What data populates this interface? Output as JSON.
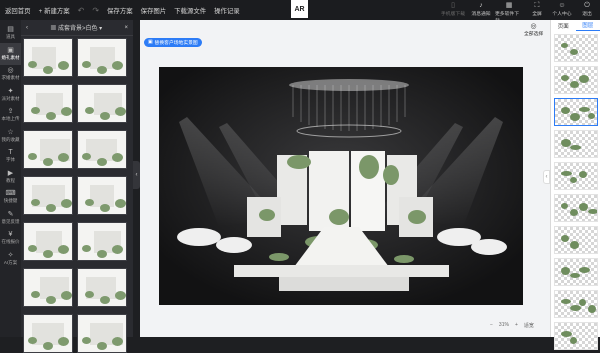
{
  "topbar": {
    "home": "返回首页",
    "new_plan": "+ 新建方案",
    "save_plan": "保存方案",
    "save_image": "保存图片",
    "download": "下载源文件",
    "history": "操作记录",
    "logo": "AR",
    "right_items": [
      {
        "label": "手机版下载",
        "icon": "phone-icon",
        "dim": true
      },
      {
        "label": "消息通知",
        "icon": "bell-icon",
        "dim": false
      },
      {
        "label": "更多软件下载",
        "icon": "grid-icon",
        "dim": false
      },
      {
        "label": "全屏",
        "icon": "fullscreen-icon",
        "dim": false
      },
      {
        "label": "个人中心",
        "icon": "user-icon",
        "dim": false
      },
      {
        "label": "退出",
        "icon": "power-icon",
        "dim": false
      }
    ]
  },
  "rail": [
    {
      "label": "道具",
      "icon": "prop-icon",
      "active": false
    },
    {
      "label": "婚礼素材",
      "icon": "image-icon",
      "active": true
    },
    {
      "label": "求婚素材",
      "icon": "ring-icon",
      "active": false
    },
    {
      "label": "派对素材",
      "icon": "party-icon",
      "active": false
    },
    {
      "label": "本地上传",
      "icon": "upload-icon",
      "active": false
    },
    {
      "label": "我的收藏",
      "icon": "star-icon",
      "active": false
    },
    {
      "label": "字体",
      "icon": "text-icon",
      "active": false
    },
    {
      "label": "教程",
      "icon": "play-icon",
      "active": false
    },
    {
      "label": "快捷键",
      "icon": "keyboard-icon",
      "active": false
    },
    {
      "label": "意见反馈",
      "icon": "pen-icon",
      "active": false
    },
    {
      "label": "在线报价",
      "icon": "quote-icon",
      "active": false
    },
    {
      "label": "AI方案",
      "icon": "ai-icon",
      "active": false
    }
  ],
  "library": {
    "title": "▦ 成套背景>白色 ▾",
    "back_icon": "‹",
    "close_icon": "×"
  },
  "stage": {
    "replace_button": "替换客户场地实景图",
    "select_all": "全部选择",
    "zoom_minus": "−",
    "zoom_value": "31%",
    "zoom_plus": "+",
    "fit_label": "适宽"
  },
  "pages_panel": {
    "tab_pages": "页面",
    "tab_layers": "图层"
  },
  "colors": {
    "accent": "#2d7cf6",
    "topbar_bg": "#1b1c1f",
    "panel_bg": "#2a2b30",
    "stage_bg": "#f2f3f5"
  }
}
